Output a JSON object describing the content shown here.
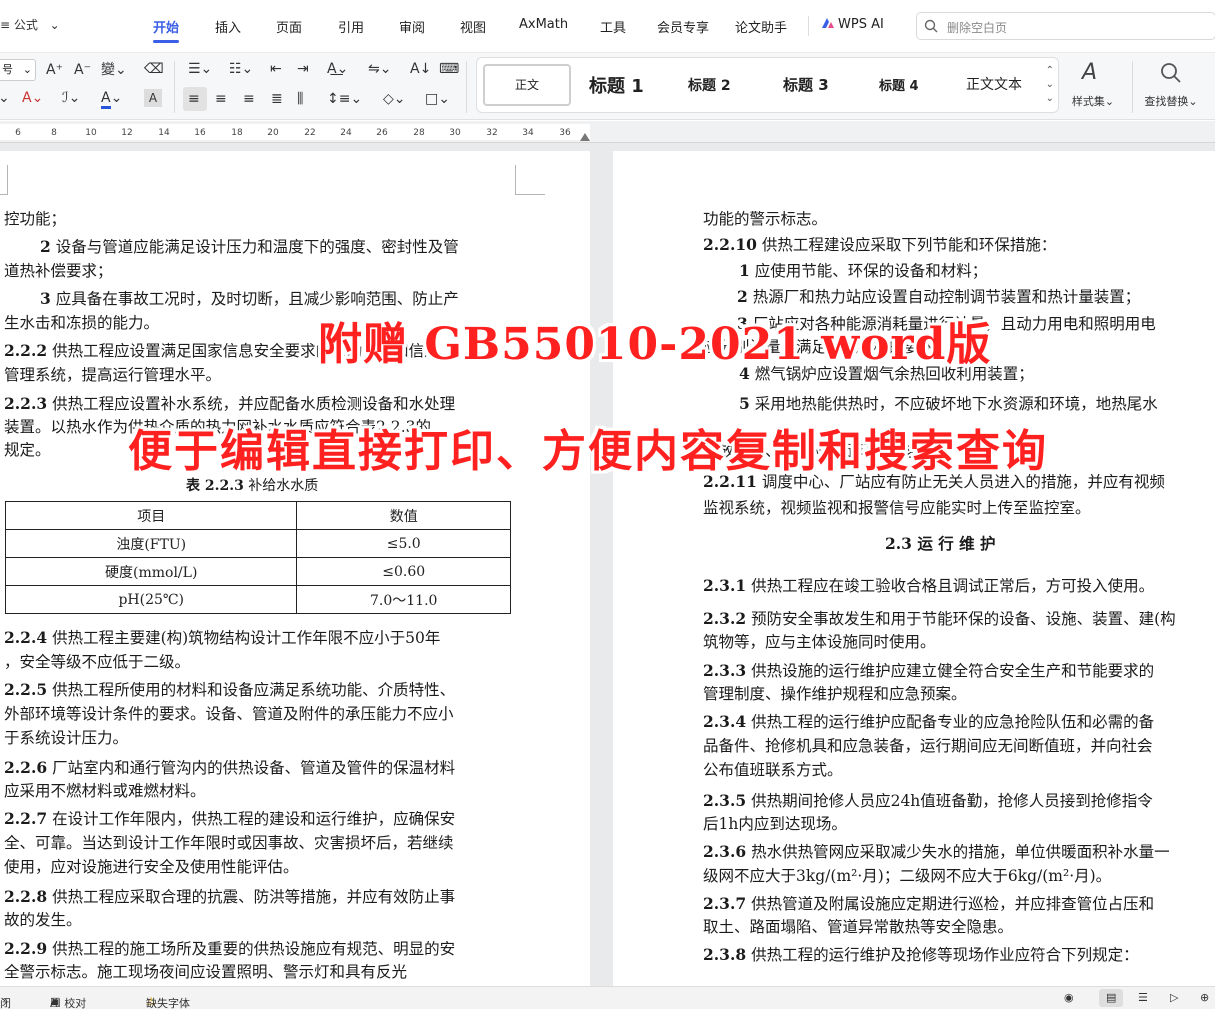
{
  "menubar": {
    "formula_label": "公式",
    "tabs": [
      {
        "label": "开始",
        "active": true
      },
      {
        "label": "插入"
      },
      {
        "label": "页面"
      },
      {
        "label": "引用"
      },
      {
        "label": "审阅"
      },
      {
        "label": "视图"
      },
      {
        "label": "AxMath"
      },
      {
        "label": "工具"
      },
      {
        "label": "会员专享"
      },
      {
        "label": "论文助手"
      },
      {
        "label": "WPS AI"
      }
    ],
    "search_placeholder": "删除空白页",
    "accent_color": "#3b5ee6"
  },
  "ribbon": {
    "font_size_fragment": "号",
    "styles": [
      "正文",
      "标题 1",
      "标题 2",
      "标题 3",
      "标题 4",
      "正文文本"
    ],
    "styles_set_label": "样式集",
    "find_replace_label": "查找替换"
  },
  "ruler": {
    "ticks": [
      "6",
      "8",
      "10",
      "12",
      "14",
      "16",
      "18",
      "20",
      "22",
      "24",
      "26",
      "28",
      "30",
      "32",
      "34",
      "36"
    ]
  },
  "left_page": {
    "lines": {
      "l1": "控功能；",
      "l2a_num": "2",
      "l2a": " 设备与管道应能满足设计压力和温度下的强度、密封性及管",
      "l2b": "道热补偿要求；",
      "l3a_num": "3",
      "l3a": " 应具备在事故工况时，及时切断，且减少影响范围、防止产",
      "l3b": "生水击和冻损的能力。",
      "s222_num": "2.2.2",
      "s222a": "  供热工程应设置满足国家信息安全要求的自动监控和信息",
      "s222b": "管理系统，提高运行管理水平。",
      "s223_num": "2.2.3",
      "s223a": "  供热工程应设置补水系统，并应配备水质检测设备和水处理",
      "s223b": "装置。以热水作为供热介质的热力网补水水质应符合表2.2.3的",
      "s223c": "规定。",
      "table_caption_num": "表 2.2.3",
      "table_caption": "  补给水水质",
      "s224_num": "2.2.4",
      "s224a": "  供热工程主要建(构)筑物结构设计工作年限不应小于50年",
      "s224b": "，安全等级不应低于二级。",
      "s225_num": "2.2.5",
      "s225a": "  供热工程所使用的材料和设备应满足系统功能、介质特性、",
      "s225b": "外部环境等设计条件的要求。设备、管道及附件的承压能力不应小",
      "s225c": "于系统设计压力。",
      "s226_num": "2.2.6",
      "s226a": "  厂站室内和通行管沟内的供热设备、管道及管件的保温材料",
      "s226b": "应采用不燃材料或难燃材料。",
      "s227_num": "2.2.7",
      "s227a": "  在设计工作年限内，供热工程的建设和运行维护，应确保安",
      "s227b": "全、可靠。当达到设计工作年限时或因事故、灾害损坏后，若继续",
      "s227c": "使用，应对设施进行安全及使用性能评估。",
      "s228_num": "2.2.8",
      "s228a": "  供热工程应采取合理的抗震、防洪等措施，并应有效防止事",
      "s228b": "故的发生。",
      "s229_num": "2.2.9",
      "s229a": "  供热工程的施工场所及重要的供热设施应有规范、明显的安",
      "s229b": "全警示标志。施工现场夜间应设置照明、警示灯和具有反光"
    },
    "table": {
      "headers": [
        "项目",
        "数值"
      ],
      "rows": [
        [
          "浊度(FTU)",
          "≤5.0"
        ],
        [
          "硬度(mmol/L)",
          "≤0.60"
        ],
        [
          "pH(25℃)",
          "7.0～11.0"
        ]
      ]
    }
  },
  "right_page": {
    "lines": {
      "r1": "功能的警示标志。",
      "s2210_num": "2.2.10",
      "s2210": "  供热工程建设应采取下列节能和环保措施：",
      "i1_num": "1",
      "i1": " 应使用节能、环保的设备和材料；",
      "i2_num": "2",
      "i2": " 热源厂和热力站应设置自动控制调节装置和热计量装置；",
      "i3_num": "3",
      "i3a": " 厂站应对各种能源消耗量进行计量，且动力用电和照明用电",
      "i3b": "应分别计量，满足节能考核的要求；",
      "i4_num": "4",
      "i4": " 燃气锅炉应设置烟气余热回收利用装置；",
      "i5_num": "5",
      "i5a": " 采用地热能供热时，不应破坏地下水资源和环境，地热尾水",
      "i5b": "排放温度、水质应满足环保要求。",
      "s2211_num": "2.2.11",
      "s2211a": "  调度中心、厂站应有防止无关人员进入的措施，并应有视频",
      "s2211b": "监视系统，视频监视和报警信号应能实时上传至监控室。",
      "h23": "2.3  运 行 维 护",
      "s231_num": "2.3.1",
      "s231": "  供热工程应在竣工验收合格且调试正常后，方可投入使用。",
      "s232_num": "2.3.2",
      "s232a": "  预防安全事故发生和用于节能环保的设备、设施、装置、建(构",
      "s232b": "筑物等，应与主体设施同时使用。",
      "s233_num": "2.3.3",
      "s233a": "  供热设施的运行维护应建立健全符合安全生产和节能要求的",
      "s233b": "管理制度、操作维护规程和应急预案。",
      "s234_num": "2.3.4",
      "s234a": "  供热工程的运行维护应配备专业的应急抢险队伍和必需的备",
      "s234b": "品备件、抢修机具和应急装备，运行期间应无间断值班，并向社会",
      "s234c": "公布值班联系方式。",
      "s235_num": "2.3.5",
      "s235a": "  供热期间抢修人员应24h值班备勤，抢修人员接到抢修指令",
      "s235b": "后1h内应到达现场。",
      "s236_num": "2.3.6",
      "s236a": "  热水供热管网应采取减少失水的措施，单位供暖面积补水量一",
      "s236b": "级网不应大于3kg/(m²·月)；二级网不应大于6kg/(m²·月)。",
      "s237_num": "2.3.7",
      "s237a": "  供热管道及附属设施应定期进行巡检，并应排查管位占压和",
      "s237b": "取土、路面塌陷、管道异常散热等安全隐患。",
      "s238_num": "2.3.8",
      "s238": "  供热工程的运行维护及抢修等现场作业应符合下列规定："
    }
  },
  "banner": {
    "line1": "附赠 GB55010-2021 word版",
    "line2": "便于编辑直接打印、方便内容复制和搜索查询",
    "color": "#ff2020"
  },
  "statusbar": {
    "left_fragment": "闭",
    "ai_check": "AI 校对",
    "missing_font": "缺失字体"
  }
}
